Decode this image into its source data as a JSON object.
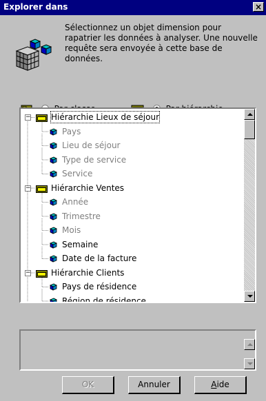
{
  "window": {
    "title": "Explorer dans",
    "close_label": "×"
  },
  "description": "Sélectionnez un objet dimension pour rapatrier les données à analyser. Une nouvelle requête sera envoyée à cette base de données.",
  "view_options": [
    {
      "label_prefix": "Par ",
      "label_underlined": "c",
      "label_rest": "lasse",
      "selected": false
    },
    {
      "label_prefix": "Par ",
      "label_underlined": "h",
      "label_rest": "iérarchie",
      "selected": true
    }
  ],
  "tree": {
    "items": [
      {
        "kind": "hierarchy",
        "label": "Hiérarchie Lieux de séjour",
        "expanded": true,
        "focused": true,
        "icon": "folder-icon"
      },
      {
        "kind": "dimension",
        "label": "Pays",
        "dim": true,
        "icon": "cube-icon"
      },
      {
        "kind": "dimension",
        "label": "Lieu de séjour",
        "dim": true,
        "icon": "cube-icon"
      },
      {
        "kind": "dimension",
        "label": "Type de service",
        "dim": true,
        "icon": "cube-icon"
      },
      {
        "kind": "dimension",
        "label": "Service",
        "dim": true,
        "icon": "cube-icon"
      },
      {
        "kind": "hierarchy",
        "label": "Hiérarchie Ventes",
        "expanded": true,
        "icon": "folder-icon"
      },
      {
        "kind": "dimension",
        "label": "Année",
        "dim": true,
        "icon": "cube-icon"
      },
      {
        "kind": "dimension",
        "label": "Trimestre",
        "dim": true,
        "icon": "cube-icon"
      },
      {
        "kind": "dimension",
        "label": "Mois",
        "dim": true,
        "icon": "cube-icon"
      },
      {
        "kind": "dimension",
        "label": "Semaine",
        "dim": false,
        "icon": "cube-icon"
      },
      {
        "kind": "dimension",
        "label": "Date de la facture",
        "dim": false,
        "icon": "cube-icon"
      },
      {
        "kind": "hierarchy",
        "label": "Hiérarchie Clients",
        "expanded": true,
        "icon": "folder-icon"
      },
      {
        "kind": "dimension",
        "label": "Pays de résidence",
        "dim": false,
        "icon": "cube-icon"
      },
      {
        "kind": "dimension",
        "label": "Région de résidence",
        "dim": false,
        "icon": "cube-icon"
      }
    ]
  },
  "buttons": {
    "ok": "OK",
    "cancel": "Annuler",
    "help_underlined": "A",
    "help_rest": "ide"
  },
  "colors": {
    "title_bar": "#000080",
    "face": "#c0c0c0",
    "dim_text": "#7f7f7f"
  }
}
